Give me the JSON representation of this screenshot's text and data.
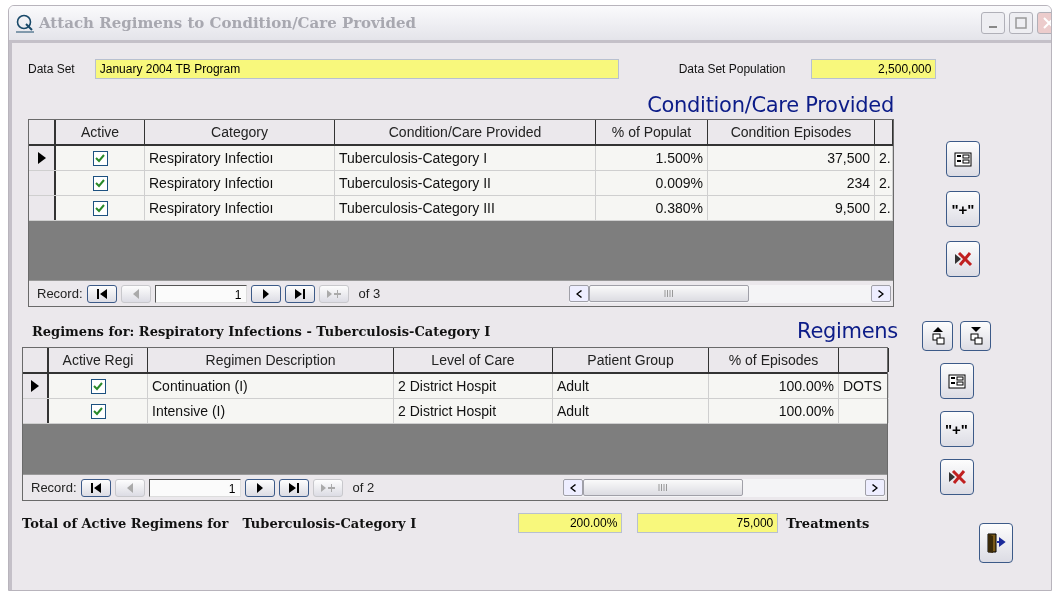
{
  "window": {
    "title": "Attach Regimens to Condition/Care Provided"
  },
  "data_set": {
    "label": "Data Set",
    "value": "January 2004 TB Program"
  },
  "population": {
    "label": "Data Set Population",
    "value": "2,500,000"
  },
  "conditions": {
    "heading": "Condition/Care Provided",
    "columns": [
      "Active",
      "Category",
      "Condition/Care Provided",
      "% of Populat",
      "Condition Episodes"
    ],
    "rows": [
      {
        "selected": true,
        "cells": [
          {
            "checked": true
          },
          "Respiratory Infectioı",
          "Tuberculosis-Category I",
          "1.500%",
          "37,500",
          "2."
        ]
      },
      {
        "selected": false,
        "cells": [
          {
            "checked": true
          },
          "Respiratory Infectioı",
          "Tuberculosis-Category II",
          "0.009%",
          "234",
          "2."
        ]
      },
      {
        "selected": false,
        "cells": [
          {
            "checked": true
          },
          "Respiratory Infectioı",
          "Tuberculosis-Category III",
          "0.380%",
          "9,500",
          "2."
        ]
      }
    ],
    "navigator": {
      "label": "Record:",
      "current": "1",
      "total": "of 3"
    }
  },
  "condition_buttons": [
    {
      "kind": "form"
    },
    {
      "kind": "add",
      "text": "\"+\""
    },
    {
      "kind": "delete"
    }
  ],
  "regimens": {
    "caption": "Regimens for:  Respiratory Infections -  Tuberculosis-Category I",
    "heading": "Regimens",
    "columns": [
      "Active Regi",
      "Regimen Description",
      "Level of Care",
      "Patient Group",
      "% of Episodes"
    ],
    "rows": [
      {
        "selected": true,
        "cells": [
          {
            "checked": true
          },
          "Continuation (I)",
          "2 District Hospit",
          "Adult",
          "100.00%",
          "DOTS"
        ]
      },
      {
        "selected": false,
        "cells": [
          {
            "checked": true
          },
          "Intensive (I)",
          "2 District Hospit",
          "Adult",
          "100.00%",
          ""
        ]
      }
    ],
    "navigator": {
      "label": "Record:",
      "current": "1",
      "total": "of 2"
    }
  },
  "regimen_buttons": [
    {
      "kind": "move-up"
    },
    {
      "kind": "move-down"
    },
    {
      "kind": "form"
    },
    {
      "kind": "add",
      "text": "\"+\""
    },
    {
      "kind": "delete"
    }
  ],
  "totals": {
    "label": "Total of Active Regimens for",
    "condition": "Tuberculosis-Category I",
    "percent": "200.00%",
    "count": "75,000",
    "unit": "Treatments"
  }
}
